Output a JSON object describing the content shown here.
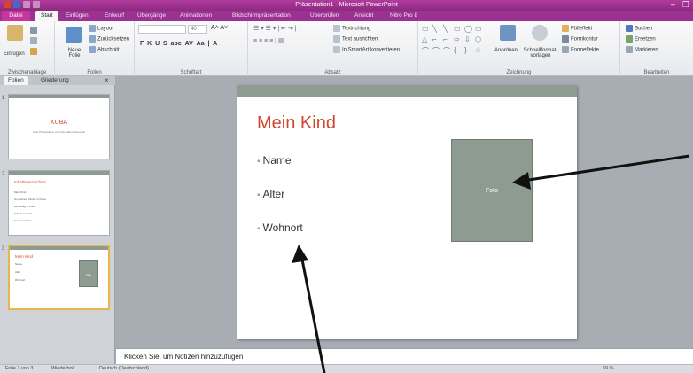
{
  "window": {
    "title": "Präsentation1 - Microsoft PowerPoint",
    "minimize": "–",
    "maximize": "❐"
  },
  "tabs": [
    "Datei",
    "Start",
    "Einfügen",
    "Entwurf",
    "Übergänge",
    "Animationen",
    "Bildschirmpräsentation",
    "Überprüfen",
    "Ansicht",
    "Nitro Pro 8"
  ],
  "ribbon": {
    "clipboard": {
      "paste": "Einfügen",
      "label": "Zwischenablage"
    },
    "slides": {
      "new_slide": "Neue Folie",
      "layout": "Layout",
      "reset": "Zurücksetzen",
      "section": "Abschnitt",
      "label": "Folien"
    },
    "font": {
      "size": "40",
      "label": "Schriftart"
    },
    "paragraph": {
      "text_direction": "Textrichtung",
      "align_text": "Text ausrichten",
      "smartart": "In SmartArt konvertieren",
      "label": "Absatz"
    },
    "drawing": {
      "arrange": "Anordnen",
      "quick_styles": "Schnellformat-vorlagen",
      "fill": "Fülleffekt",
      "outline": "Formkontur",
      "effects": "Formeffekte",
      "label": "Zeichnung"
    },
    "editing": {
      "find": "Suchen",
      "replace": "Ersetzen",
      "select": "Markieren",
      "label": "Bearbeiten"
    }
  },
  "panel": {
    "tabs": [
      "Folien",
      "Gliederung"
    ],
    "close": "×"
  },
  "thumbnails": [
    {
      "num": "1",
      "title": "KUBA",
      "subtitle": "Eine Präsentation von Frau Hahn Klasse 3a"
    },
    {
      "num": "2",
      "title": "Inhaltsverzeichnis",
      "items": [
        "Mein Kind",
        "So wohnen Kinder in Kuba",
        "Der Alltag in Kuba",
        "Schule in Kuba",
        "Essen in Kuba"
      ]
    },
    {
      "num": "3",
      "title": "Mein Kind",
      "items": [
        "Name",
        "Alter",
        "Wohnort"
      ],
      "foto": "Foto"
    }
  ],
  "slide": {
    "title": "Mein Kind",
    "bullets": [
      "Name",
      "Alter",
      "Wohnort"
    ],
    "foto": "Foto"
  },
  "notes_placeholder": "Klicken Sie, um Notizen hinzuzufügen",
  "statusbar": {
    "slide_info": "Folie 3 von 3",
    "theme": "Wiederholt",
    "language": "Deutsch (Deutschland)",
    "zoom": "69 %"
  },
  "colors": {
    "accent": "#d2472f",
    "title_bar": "#9b3190",
    "slide_bar": "#8e9b90"
  }
}
